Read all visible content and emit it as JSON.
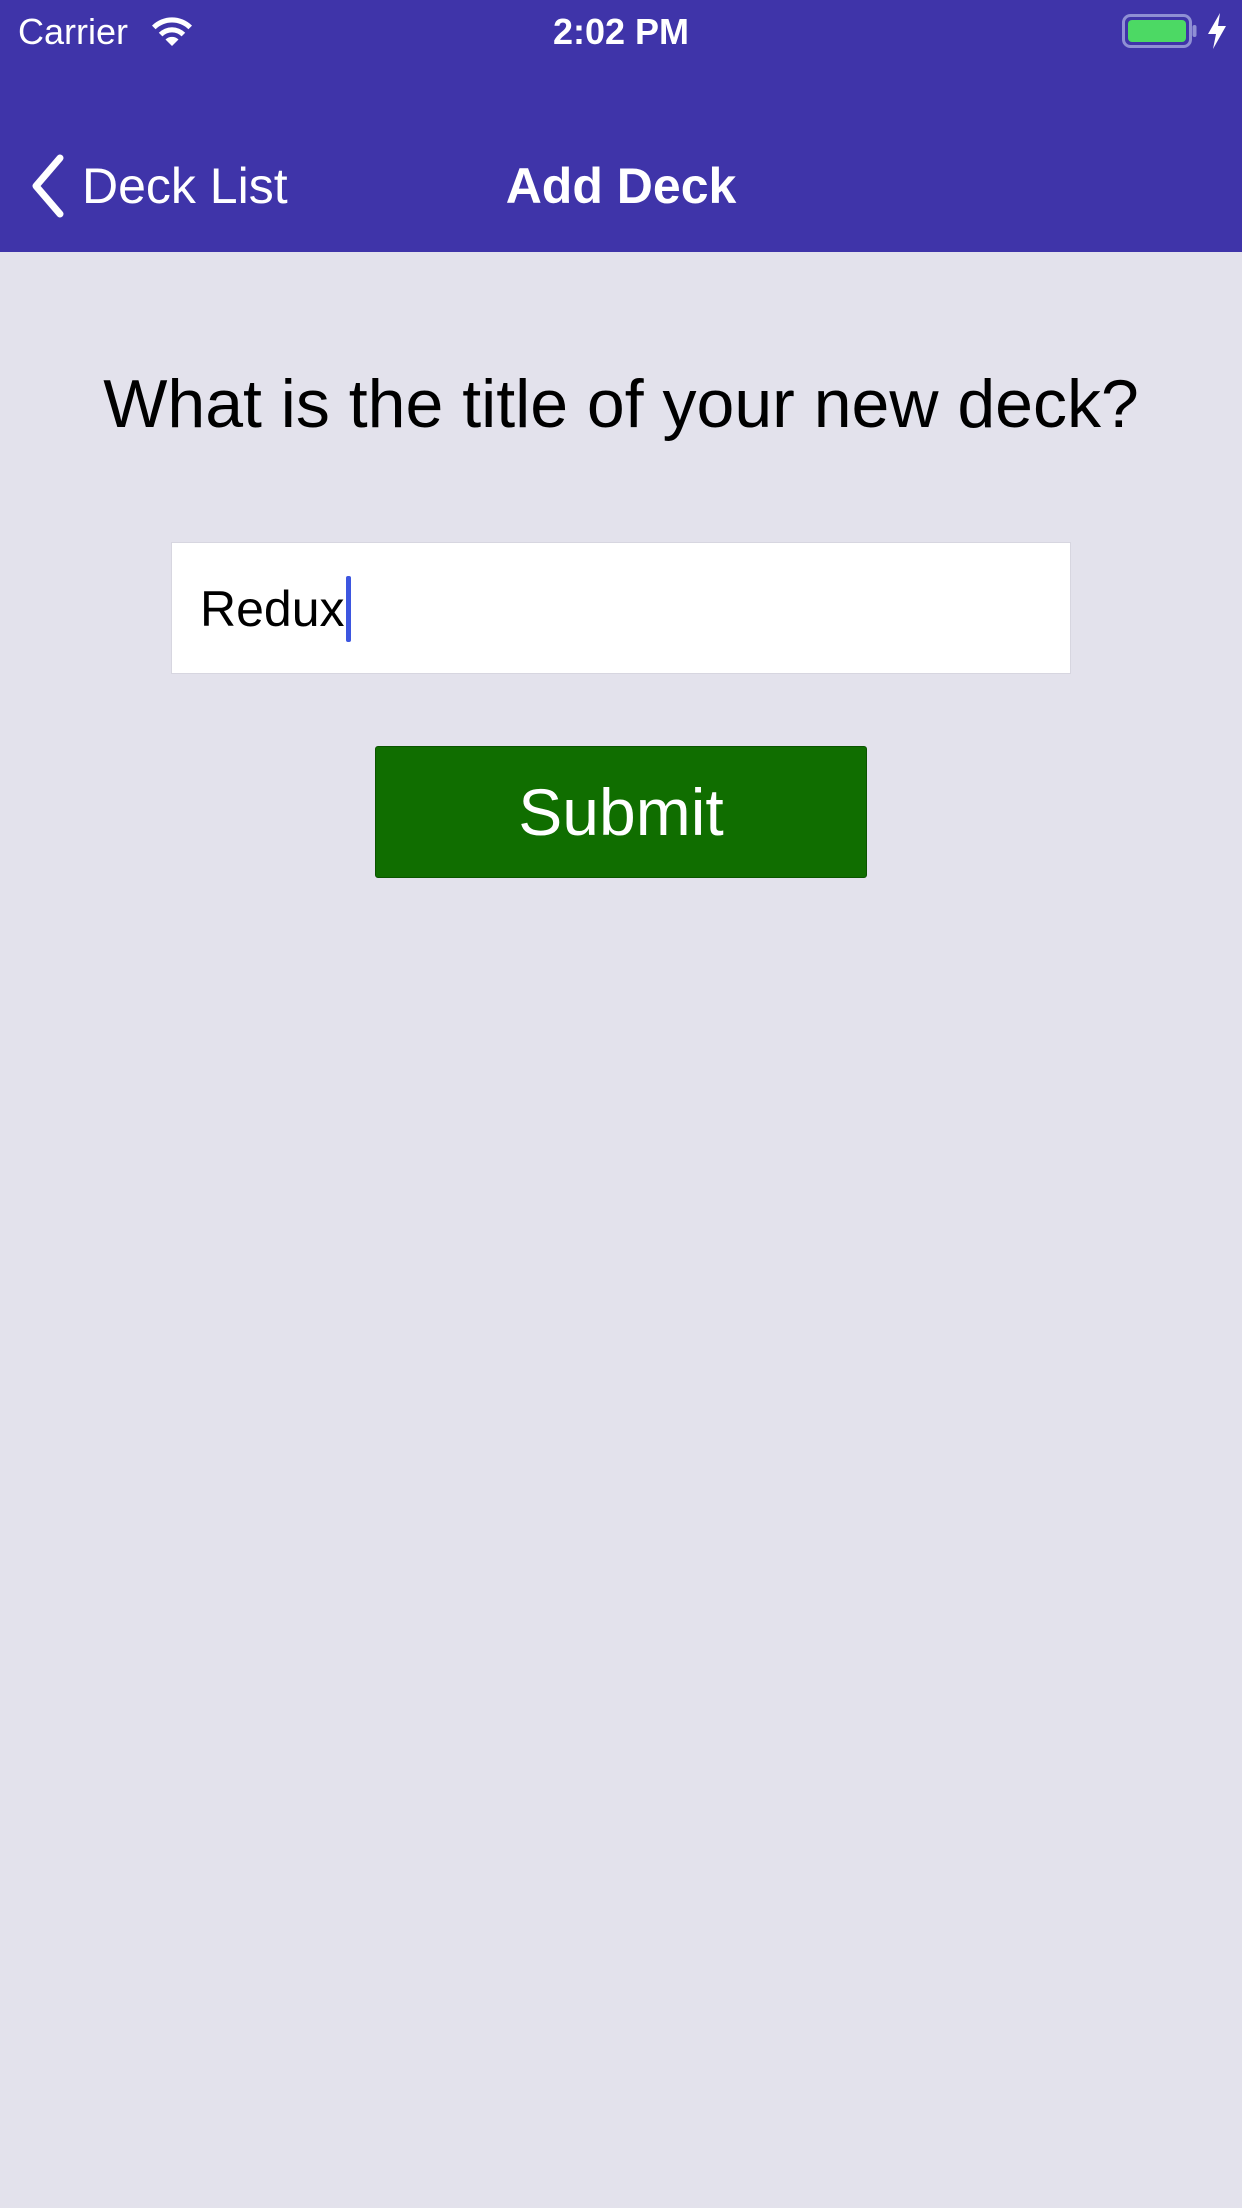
{
  "status_bar": {
    "carrier": "Carrier",
    "time": "2:02 PM",
    "wifi_icon": "wifi-icon",
    "battery_icon": "battery-charging-icon",
    "battery_level": 1.0,
    "battery_color": "#4cd964"
  },
  "nav": {
    "back_label": "Deck List",
    "back_icon": "chevron-left-icon",
    "title": "Add Deck",
    "background_color": "#3f34a9"
  },
  "form": {
    "prompt": "What is the title of your new deck?",
    "title_input_value": "Redux",
    "submit_label": "Submit",
    "submit_color": "#106e00",
    "caret_color": "#3d56e0"
  },
  "page": {
    "background_color": "#e3e2ec"
  }
}
